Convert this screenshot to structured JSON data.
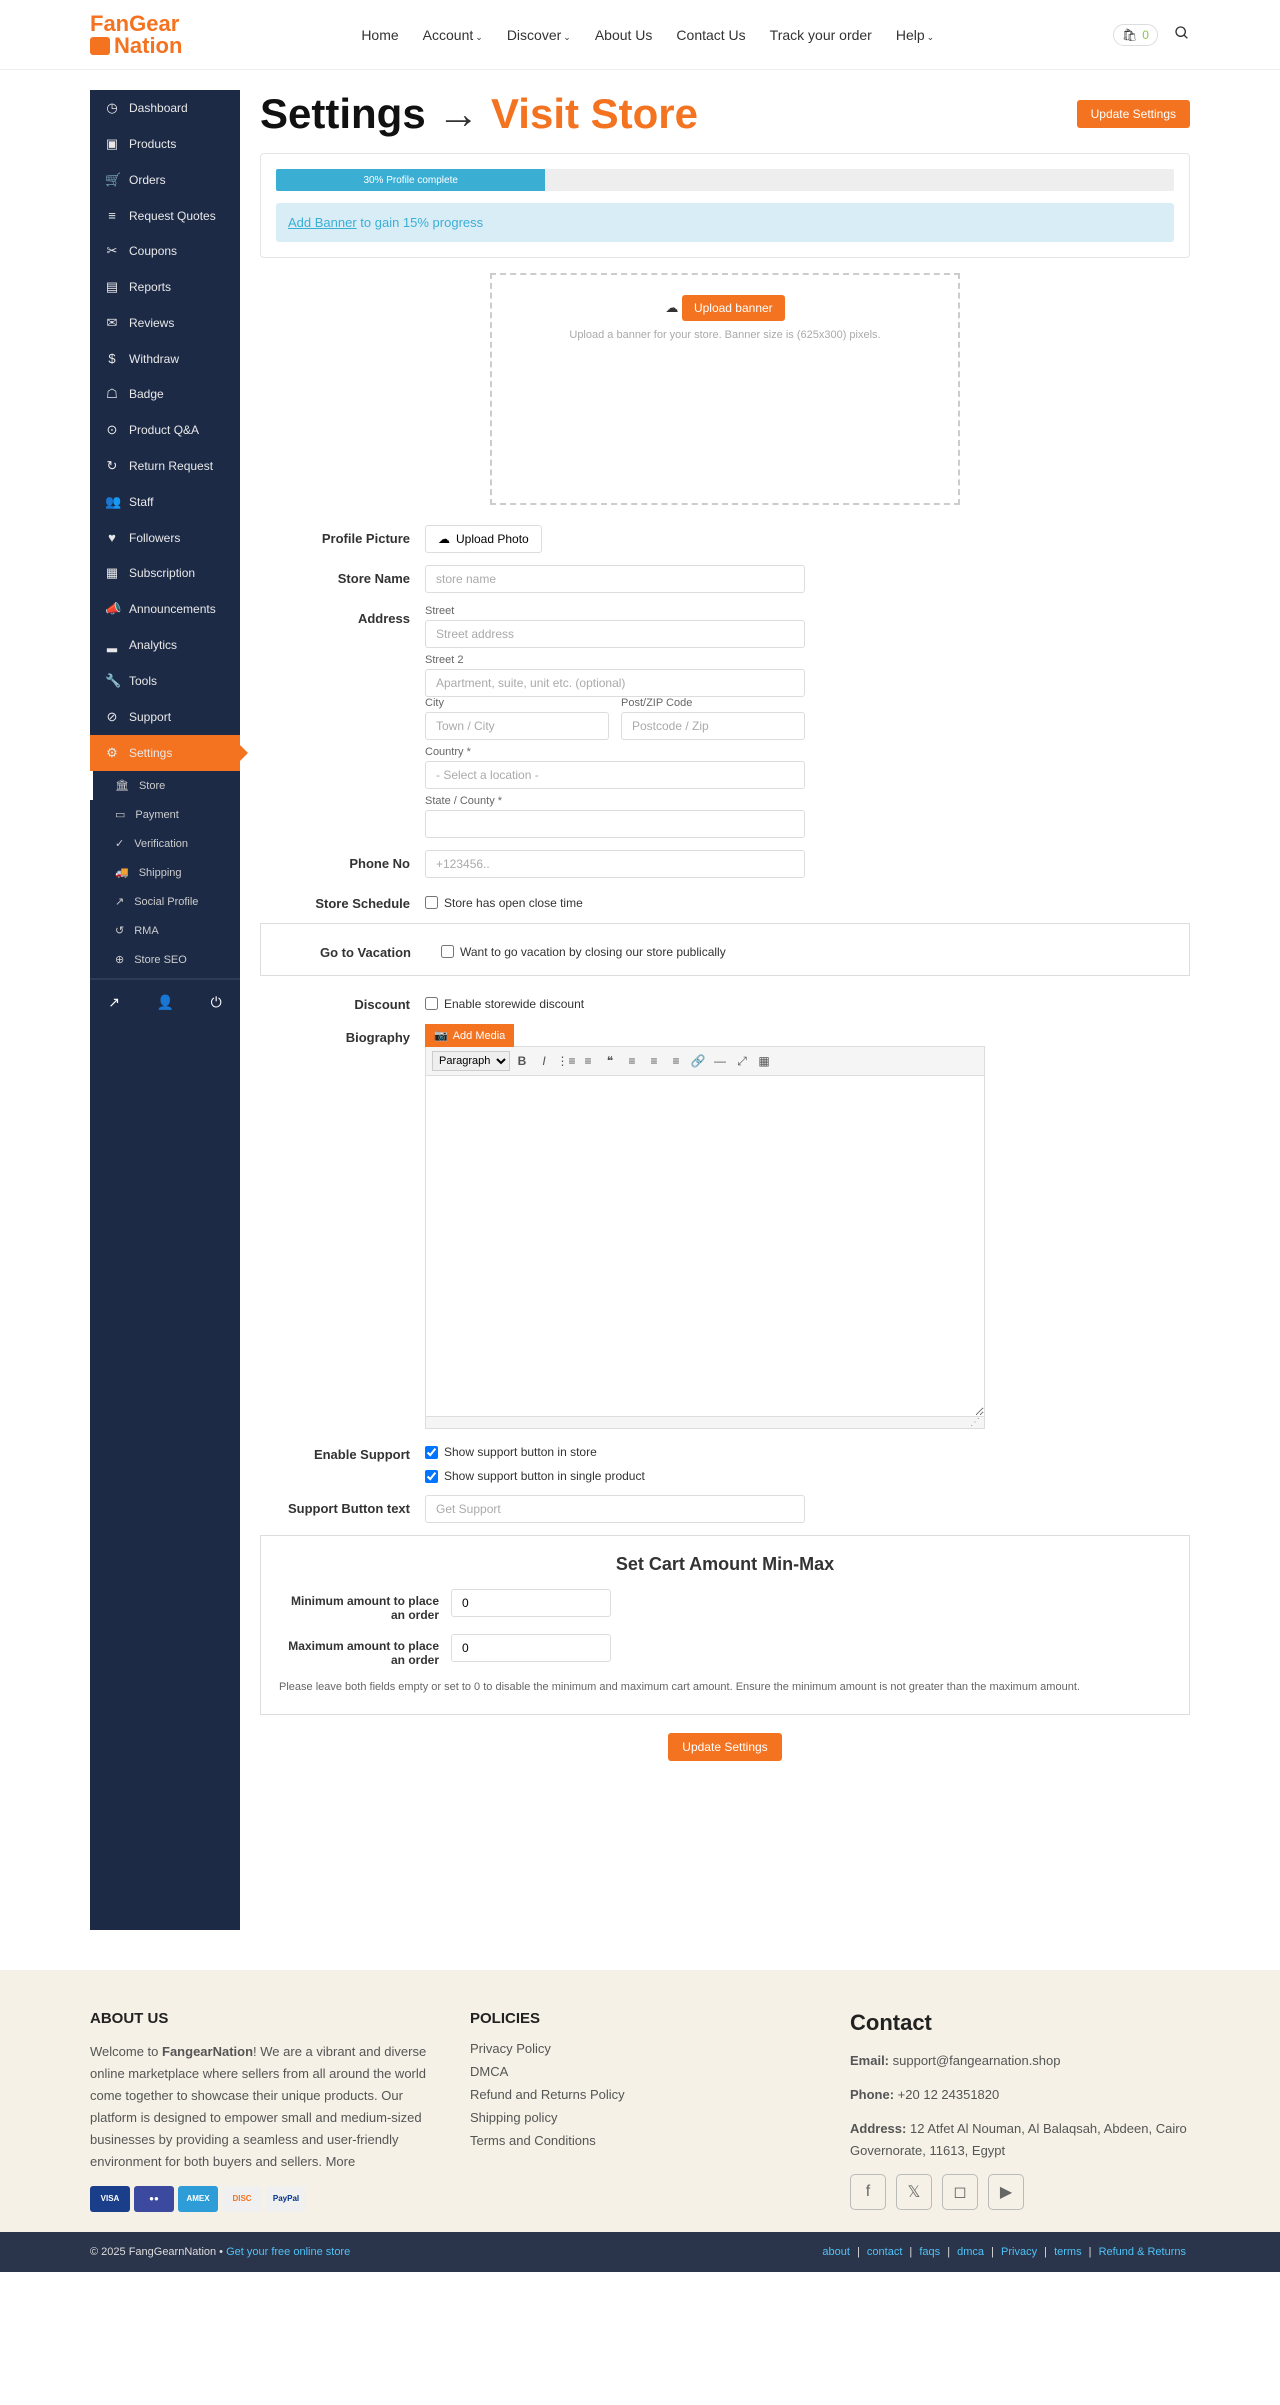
{
  "brand": {
    "l1": "FanGear",
    "l2": "Nation"
  },
  "nav": {
    "items": [
      "Home",
      "Account",
      "Discover",
      "About Us",
      "Contact Us",
      "Track your order",
      "Help"
    ],
    "dropdown": [
      false,
      true,
      true,
      false,
      false,
      false,
      true
    ],
    "cart_count": "0"
  },
  "sidebar": {
    "items": [
      {
        "icon": "◷",
        "label": "Dashboard"
      },
      {
        "icon": "▣",
        "label": "Products"
      },
      {
        "icon": "🛒",
        "label": "Orders"
      },
      {
        "icon": "≡",
        "label": "Request Quotes"
      },
      {
        "icon": "✂",
        "label": "Coupons"
      },
      {
        "icon": "▤",
        "label": "Reports"
      },
      {
        "icon": "✉",
        "label": "Reviews"
      },
      {
        "icon": "$",
        "label": "Withdraw"
      },
      {
        "icon": "☖",
        "label": "Badge"
      },
      {
        "icon": "⊙",
        "label": "Product Q&A"
      },
      {
        "icon": "↻",
        "label": "Return Request"
      },
      {
        "icon": "👥",
        "label": "Staff"
      },
      {
        "icon": "♥",
        "label": "Followers"
      },
      {
        "icon": "▦",
        "label": "Subscription"
      },
      {
        "icon": "📣",
        "label": "Announcements"
      },
      {
        "icon": "▂",
        "label": "Analytics"
      },
      {
        "icon": "🔧",
        "label": "Tools"
      },
      {
        "icon": "⊘",
        "label": "Support"
      },
      {
        "icon": "⚙",
        "label": "Settings"
      }
    ],
    "subs": [
      {
        "icon": "🏛",
        "label": "Store"
      },
      {
        "icon": "▭",
        "label": "Payment"
      },
      {
        "icon": "✓",
        "label": "Verification"
      },
      {
        "icon": "🚚",
        "label": "Shipping"
      },
      {
        "icon": "↗",
        "label": "Social Profile"
      },
      {
        "icon": "↺",
        "label": "RMA"
      },
      {
        "icon": "⊕",
        "label": "Store SEO"
      }
    ],
    "footer_icons": [
      "↗",
      "👤",
      "⏻"
    ]
  },
  "page": {
    "title": "Settings",
    "arrow": "→",
    "visit": "Visit Store",
    "update": "Update Settings",
    "progress_text": "30% Profile complete",
    "hint_link": "Add Banner",
    "hint_text": " to gain 15% progress",
    "upload_btn": "Upload banner",
    "upload_hint": "Upload a banner for your store. Banner size is (625x300) pixels."
  },
  "form": {
    "profile_pic": "Profile Picture",
    "upload_photo": "Upload Photo",
    "store_name": "Store Name",
    "store_name_ph": "store name",
    "address": "Address",
    "street": "Street",
    "street_ph": "Street address",
    "street2": "Street 2",
    "street2_ph": "Apartment, suite, unit etc. (optional)",
    "city": "City",
    "city_ph": "Town / City",
    "zip": "Post/ZIP Code",
    "zip_ph": "Postcode / Zip",
    "country": "Country *",
    "country_ph": "- Select a location -",
    "state": "State / County *",
    "phone": "Phone No",
    "phone_ph": "+123456..",
    "schedule": "Store Schedule",
    "schedule_chk": "Store has open close time",
    "vacation": "Go to Vacation",
    "vacation_chk": "Want to go vacation by closing our store publically",
    "discount": "Discount",
    "discount_chk": "Enable storewide discount",
    "bio": "Biography",
    "add_media": "Add Media",
    "para": "Paragraph",
    "support": "Enable Support",
    "support_chk1": "Show support button in store",
    "support_chk2": "Show support button in single product",
    "support_text": "Support Button text",
    "support_text_ph": "Get Support",
    "cart_title": "Set Cart Amount Min-Max",
    "min_lbl": "Minimum amount to place an order",
    "max_lbl": "Maximum amount to place an order",
    "min_val": "0",
    "max_val": "0",
    "cart_hint": "Please leave both fields empty or set to 0 to disable the minimum and maximum cart amount. Ensure the minimum amount is not greater than the maximum amount."
  },
  "footer": {
    "about_h": "ABOUT US",
    "about_b": "Welcome to ",
    "about_brand": "FangearNation",
    "about_t": "! We are a vibrant and diverse online marketplace where sellers from all around the world come together to showcase their unique products. Our platform is designed to empower small and medium-sized businesses by providing a seamless and user-friendly environment for both buyers and sellers. More",
    "pol_h": "POLICIES",
    "pol": [
      "Privacy Policy",
      "DMCA",
      "Refund and Returns Policy",
      "Shipping policy",
      "Terms and Conditions"
    ],
    "contact_h": "Contact",
    "email_l": "Email:",
    "email": " support@fangearnation.shop",
    "phone_l": "Phone:",
    "phone": " +20 12 24351820",
    "addr_l": "Address:",
    "addr": " 12 Atfet Al Nouman, Al Balaqsah, Abdeen, Cairo Governorate, 11613, Egypt"
  },
  "bottom": {
    "copy": "© 2025 FangGearnNation • ",
    "link": "Get your free online store",
    "links": [
      "about",
      "contact",
      "faqs",
      "dmca",
      "Privacy",
      "terms",
      "Refund & Returns"
    ]
  }
}
